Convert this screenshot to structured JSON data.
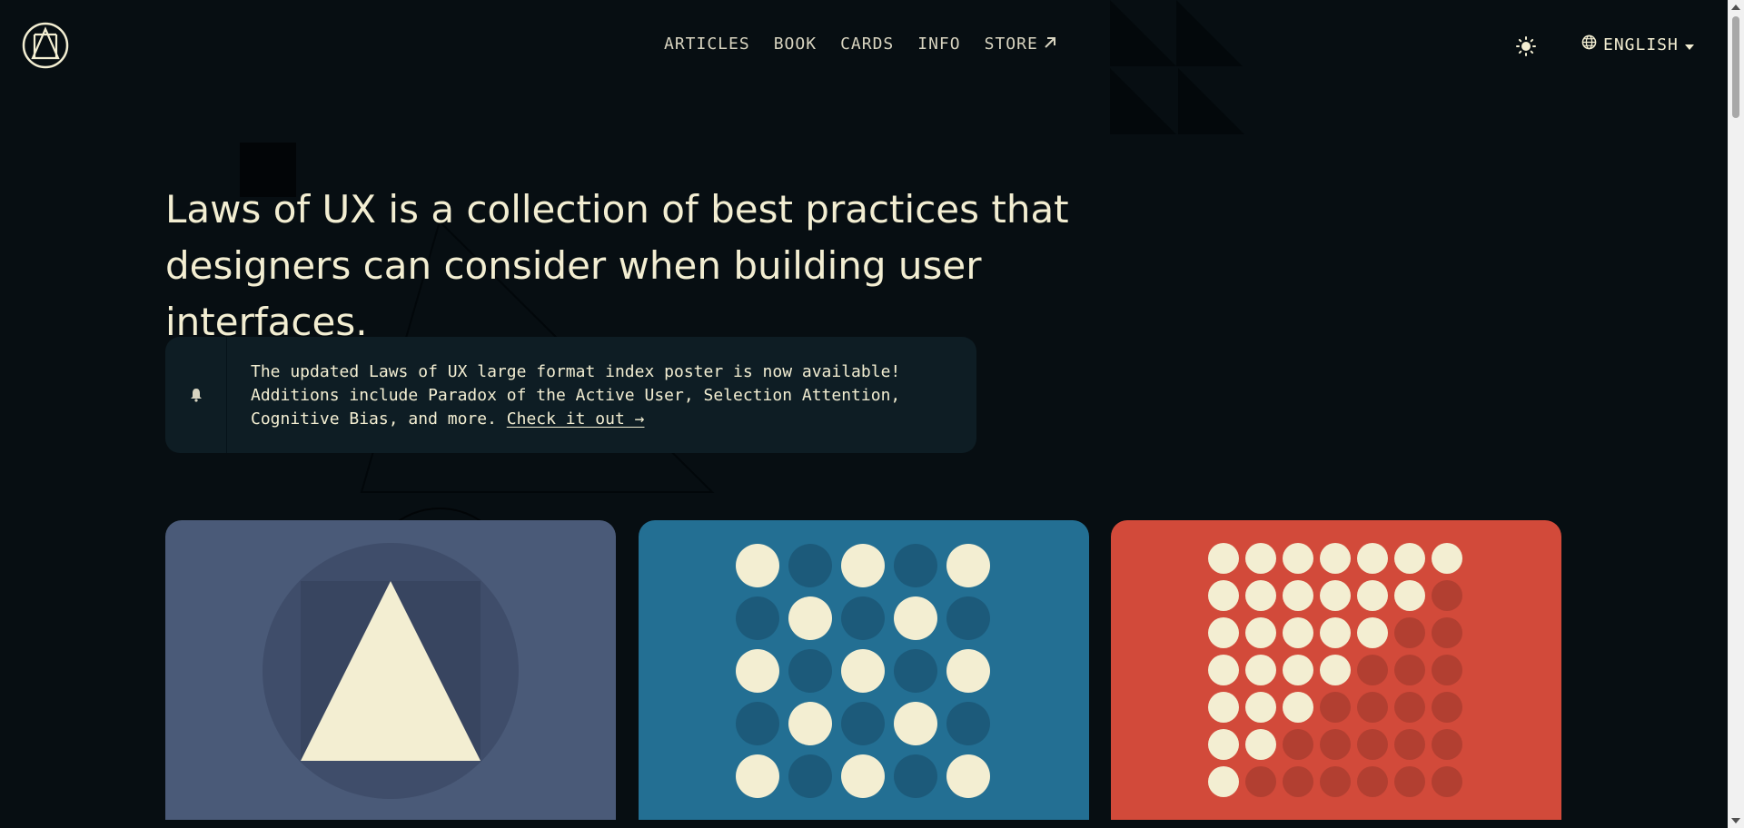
{
  "nav": {
    "items": [
      {
        "label": "ARTICLES",
        "external": false
      },
      {
        "label": "BOOK",
        "external": false
      },
      {
        "label": "CARDS",
        "external": false
      },
      {
        "label": "INFO",
        "external": false
      },
      {
        "label": "STORE",
        "external": true
      }
    ]
  },
  "header": {
    "logo_icon": "laws-of-ux-logo-icon",
    "theme_icon": "sun-icon",
    "language_icon": "globe-icon",
    "language_label": "ENGLISH"
  },
  "hero": {
    "line1": "Laws of UX is a collection of best practices that",
    "line2": "designers can consider when building user interfaces."
  },
  "notice": {
    "icon": "bell-icon",
    "line1": "The updated Laws of UX large format index poster is now available!",
    "line2": "Additions include Paradox of the Active User, Selection Attention,",
    "line3_prefix": "Cognitive Bias, and more. ",
    "link_label": "Check it out →"
  },
  "cards": [
    {
      "name": "card-triangle",
      "color": "#4a5a78"
    },
    {
      "name": "card-dots-checker",
      "color": "#236f93"
    },
    {
      "name": "card-dots-staircase",
      "color": "#d24a3a"
    }
  ],
  "colors": {
    "background": "#070e12",
    "cream": "#f3eed2",
    "notice_bg": "#0e1d24"
  }
}
